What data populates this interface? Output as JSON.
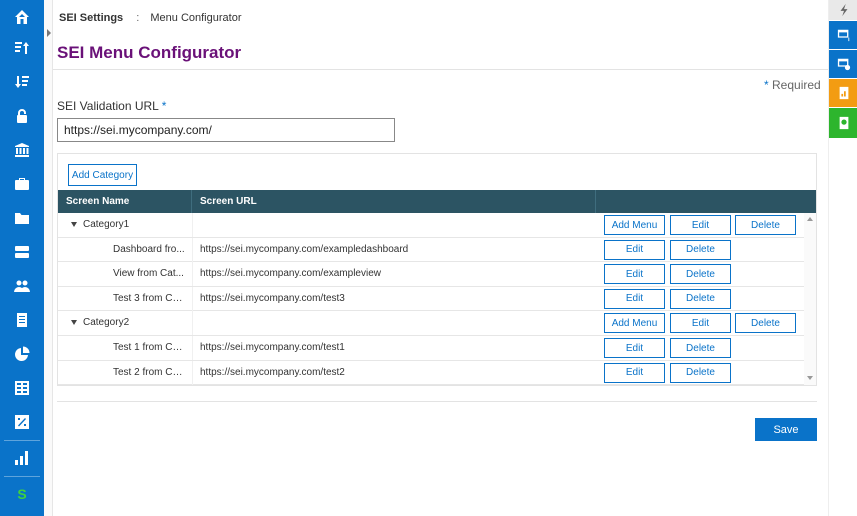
{
  "breadcrumb": {
    "root": "SEI Settings",
    "separator": ":",
    "current": "Menu Configurator"
  },
  "page": {
    "title": "SEI Menu Configurator"
  },
  "form": {
    "required_star": "*",
    "required_text": "Required",
    "url_label": "SEI Validation URL",
    "url_value": "https://sei.mycompany.com/"
  },
  "categories_panel": {
    "add_category_label": "Add Category",
    "columns": {
      "name": "Screen Name",
      "url": "Screen URL",
      "actions": ""
    },
    "rows": [
      {
        "kind": "category",
        "name": "Category1",
        "url": "",
        "buttons": [
          "Add Menu",
          "Edit",
          "Delete"
        ]
      },
      {
        "kind": "screen",
        "name": "Dashboard fro...",
        "url": "https://sei.mycompany.com/exampledashboard",
        "buttons": [
          "Edit",
          "Delete"
        ]
      },
      {
        "kind": "screen",
        "name": "View from Cat...",
        "url": "https://sei.mycompany.com/exampleview",
        "buttons": [
          "Edit",
          "Delete"
        ]
      },
      {
        "kind": "screen",
        "name": "Test 3 from Cat...",
        "url": "https://sei.mycompany.com/test3",
        "buttons": [
          "Edit",
          "Delete"
        ]
      },
      {
        "kind": "category",
        "name": "Category2",
        "url": "",
        "buttons": [
          "Add Menu",
          "Edit",
          "Delete"
        ]
      },
      {
        "kind": "screen",
        "name": "Test 1 from Cat...",
        "url": "https://sei.mycompany.com/test1",
        "buttons": [
          "Edit",
          "Delete"
        ]
      },
      {
        "kind": "screen",
        "name": "Test 2 from Cat...",
        "url": "https://sei.mycompany.com/test2",
        "buttons": [
          "Edit",
          "Delete"
        ]
      }
    ]
  },
  "footer": {
    "save_label": "Save"
  },
  "left_nav": {
    "items": [
      {
        "icon": "home-icon"
      },
      {
        "icon": "sort-ascending-icon"
      },
      {
        "icon": "sort-descending-icon"
      },
      {
        "icon": "lock-icon"
      },
      {
        "icon": "bank-icon"
      },
      {
        "icon": "briefcase-icon"
      },
      {
        "icon": "folder-icon"
      },
      {
        "icon": "server-icon"
      },
      {
        "icon": "users-icon"
      },
      {
        "icon": "document-icon"
      },
      {
        "icon": "pie-chart-icon"
      },
      {
        "icon": "table-icon"
      },
      {
        "icon": "percent-icon"
      },
      {
        "icon": "bar-chart-icon"
      },
      {
        "icon": "s-logo-icon",
        "label": "S"
      }
    ]
  },
  "right_strip": {
    "items": [
      {
        "icon": "lightning-icon",
        "color": "#e9e9e9"
      },
      {
        "icon": "window-one-icon",
        "color": "#0a73c9",
        "label": "1"
      },
      {
        "icon": "window-check-icon",
        "color": "#0a73c9"
      },
      {
        "icon": "report-chart-icon",
        "color": "#f39c12"
      },
      {
        "icon": "report-search-icon",
        "color": "#2db52d"
      }
    ]
  },
  "colors": {
    "nav_blue": "#0a73c9",
    "title_purple": "#6a1178",
    "grid_header": "#2c5463"
  }
}
